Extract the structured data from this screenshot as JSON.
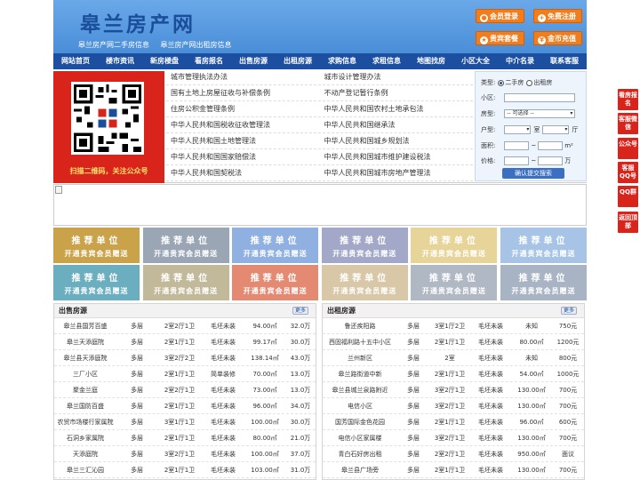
{
  "header": {
    "logo": "皋兰房产网",
    "sub_links": [
      "皋兰房产网二手房信息",
      "皋兰房产网出租房信息"
    ],
    "buttons": [
      "会员登录",
      "免费注册",
      "贵宾套餐",
      "金币充值"
    ]
  },
  "nav": [
    "网站首页",
    "楼市资讯",
    "新房楼盘",
    "看房报名",
    "出售房源",
    "出租房源",
    "求购信息",
    "求租信息",
    "地图找房",
    "小区大全",
    "中介名录",
    "联系客服"
  ],
  "qr_caption": "扫描二维码，关注公众号",
  "law_links": [
    [
      "城市管理执法办法",
      "城市设计管理办法"
    ],
    [
      "国有土地上房屋征收与补偿条例",
      "不动产登记暂行条例"
    ],
    [
      "住房公积金管理条例",
      "中华人民共和国农村土地承包法"
    ],
    [
      "中华人民共和国税收征收管理法",
      "中华人民共和国继承法"
    ],
    [
      "中华人民共和国土地管理法",
      "中华人民共和国城乡规划法"
    ],
    [
      "中华人民共和国国家赔偿法",
      "中华人民共和国城市维护建设税法"
    ],
    [
      "中华人民共和国契税法",
      "中华人民共和国城市房地产管理法"
    ]
  ],
  "search": {
    "type_label": "类型:",
    "type_options": [
      "二手房",
      "出租房"
    ],
    "community_label": "小区:",
    "property_label": "房型:",
    "property_select": "-- 可选择 --",
    "layout_label": "户型:",
    "room_unit": "室",
    "hall_unit": "厅",
    "area_label": "面积:",
    "area_unit": "m²",
    "price_label": "价格:",
    "price_unit": "万",
    "range_sep": "~",
    "submit": "确认提交搜索"
  },
  "promo": {
    "title": "推荐单位",
    "subtitle": "开通贵宾会员赠送",
    "colors": [
      "#c9a24a",
      "#9aa6b4",
      "#8fb0e0",
      "#a3a8c8",
      "#e6d498",
      "#a7c4e6",
      "#6aaec0",
      "#c2b89a",
      "#e58a72",
      "#d8c8a8",
      "#b0b8c4",
      "#a8b4c4"
    ]
  },
  "sale": {
    "title": "出售房源",
    "more": "更多",
    "rows": [
      [
        "皋兰县国芳百盛",
        "多层",
        "2室2厅1卫",
        "毛坯未装",
        "94.00㎡",
        "32.0万"
      ],
      [
        "皋兰天添庭院",
        "多层",
        "2室1厅1卫",
        "毛坯未装",
        "99.17㎡",
        "30.0万"
      ],
      [
        "皋兰县天添庭院",
        "多层",
        "3室2厅2卫",
        "毛坯未装",
        "138.14㎡",
        "43.0万"
      ],
      [
        "三厂小区",
        "多层",
        "2室1厅1卫",
        "简单装修",
        "70.00㎡",
        "13.0万"
      ],
      [
        "聚金兰庭",
        "多层",
        "2室2厅1卫",
        "毛坯未装",
        "73.00㎡",
        "13.0万"
      ],
      [
        "皋兰国防百盛",
        "多层",
        "2室1厅1卫",
        "毛坯未装",
        "96.00㎡",
        "34.0万"
      ],
      [
        "农贸市场楼行家属院",
        "多层",
        "3室1厅1卫",
        "毛坯未装",
        "100.00㎡",
        "30.0万"
      ],
      [
        "石洞乡家属院",
        "多层",
        "2室1厅1卫",
        "毛坯未装",
        "80.00㎡",
        "21.0万"
      ],
      [
        "天添庭院",
        "多层",
        "3室2厅1卫",
        "毛坯未装",
        "100.00㎡",
        "37.0万"
      ],
      [
        "皋兰三汇沁园",
        "多层",
        "2室1厅1卫",
        "毛坯未装",
        "103.00㎡",
        "31.0万"
      ]
    ]
  },
  "rent": {
    "title": "出租房源",
    "more": "更多",
    "rows": [
      [
        "鲁还疾阳路",
        "多层",
        "3室1厅2卫",
        "毛坯未装",
        "未知",
        "750元"
      ],
      [
        "西固福利路十五中小区",
        "多层",
        "2室1厅1卫",
        "毛坯未装",
        "80.00㎡",
        "1200元"
      ],
      [
        "兰州新区",
        "多层",
        "2室",
        "毛坯未装",
        "未知",
        "800元"
      ],
      [
        "皋兰路街道中新",
        "多层",
        "2室1厅1卫",
        "毛坯未装",
        "54.00㎡",
        "1000元"
      ],
      [
        "皋兰县城兰泉路附近",
        "多层",
        "3室2厅1卫",
        "毛坯未装",
        "130.00㎡",
        "700元"
      ],
      [
        "电信小区",
        "多层",
        "3室2厅1卫",
        "毛坯未装",
        "130.00㎡",
        "700元"
      ],
      [
        "国芳国际金色花园",
        "多层",
        "2室1厅1卫",
        "毛坯未装",
        "96.00㎡",
        "600元"
      ],
      [
        "电信小区家属楼",
        "多层",
        "3室2厅1卫",
        "毛坯未装",
        "130.00㎡",
        "700元"
      ],
      [
        "青白石好房出租",
        "多层",
        "2室2厅1卫",
        "毛坯未装",
        "950.00㎡",
        "面议"
      ],
      [
        "皋兰县广场旁",
        "多层",
        "2室1厅1卫",
        "毛坯未装",
        "130.00㎡",
        "700元"
      ]
    ]
  },
  "side_tools": [
    "看房报名",
    "客服微信",
    "公众号",
    "客服QQ号",
    "QQ群",
    "返回顶部"
  ]
}
